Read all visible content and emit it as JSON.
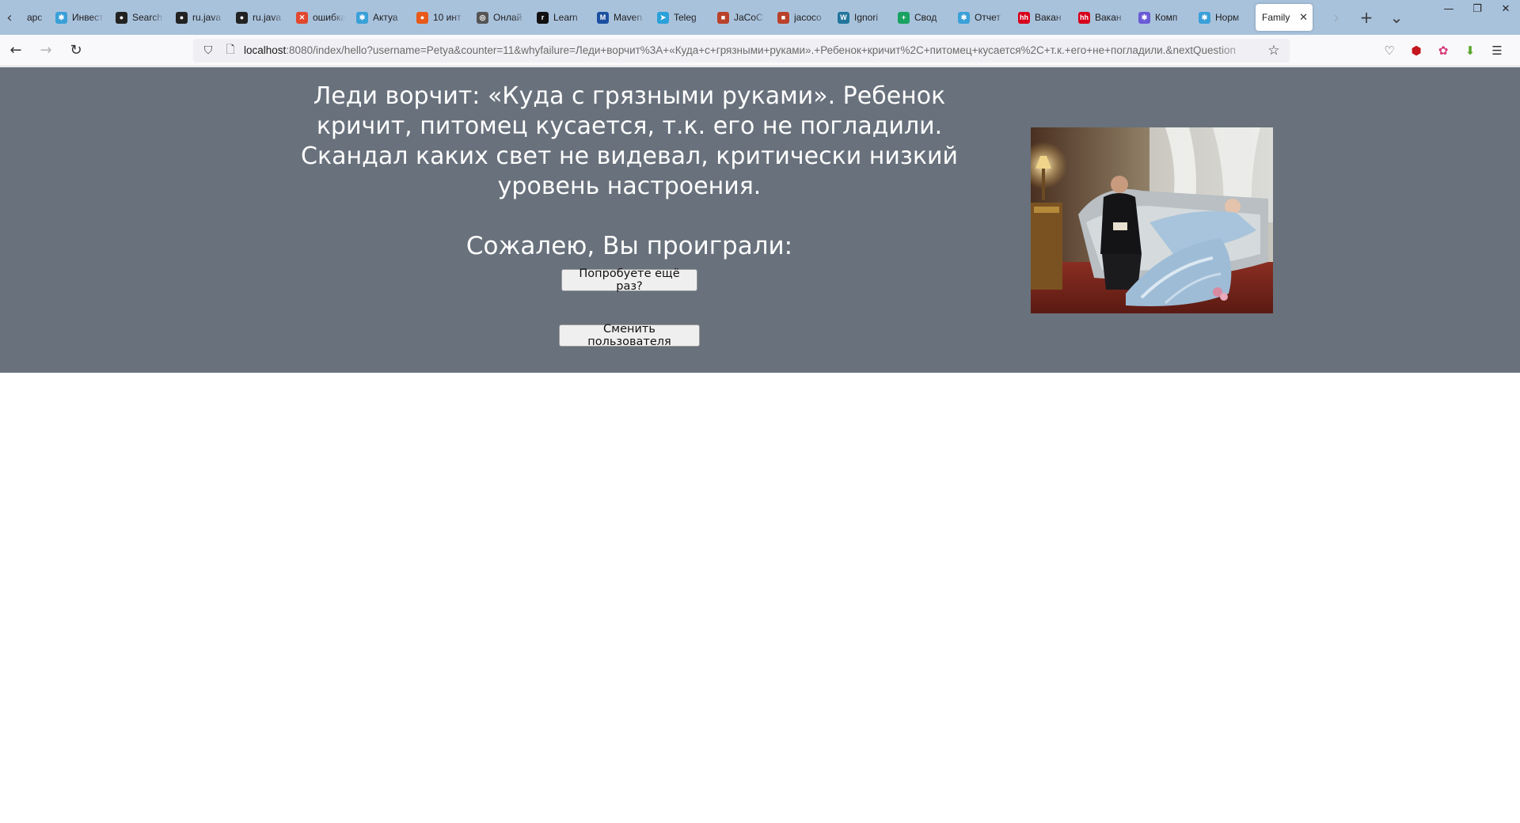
{
  "browser": {
    "tabs": [
      {
        "label": "арс",
        "color": "#7c93a8",
        "glyph": ""
      },
      {
        "label": "Инвест",
        "color": "#3aa0d8",
        "glyph": "✱"
      },
      {
        "label": "Search",
        "color": "#222222",
        "glyph": "●"
      },
      {
        "label": "ru.java",
        "color": "#222222",
        "glyph": "●"
      },
      {
        "label": "ru.java",
        "color": "#222222",
        "glyph": "●"
      },
      {
        "label": "ошибка",
        "color": "#e2482e",
        "glyph": "✕"
      },
      {
        "label": "Актуа",
        "color": "#3aa0d8",
        "glyph": "✱"
      },
      {
        "label": "10 инт",
        "color": "#e85a1a",
        "glyph": "●"
      },
      {
        "label": "Онлай",
        "color": "#555555",
        "glyph": "◎"
      },
      {
        "label": "Learn",
        "color": "#111111",
        "glyph": "r"
      },
      {
        "label": "Maven",
        "color": "#1c4fa0",
        "glyph": "M"
      },
      {
        "label": "Teleg",
        "color": "#2aa1da",
        "glyph": "➤"
      },
      {
        "label": "JaCoC",
        "color": "#b9412a",
        "glyph": "■"
      },
      {
        "label": "jacoco",
        "color": "#b9412a",
        "glyph": "■"
      },
      {
        "label": "Ignori",
        "color": "#21759b",
        "glyph": "W"
      },
      {
        "label": "Свод",
        "color": "#1aa260",
        "glyph": "+"
      },
      {
        "label": "Отчет",
        "color": "#3aa0d8",
        "glyph": "✱"
      },
      {
        "label": "Вакан",
        "color": "#d6001c",
        "glyph": "hh"
      },
      {
        "label": "Вакан",
        "color": "#d6001c",
        "glyph": "hh"
      },
      {
        "label": "Комп",
        "color": "#6b5bd6",
        "glyph": "✱"
      },
      {
        "label": "Норм",
        "color": "#3aa0d8",
        "glyph": "✱"
      }
    ],
    "active_tab": {
      "label": "Family",
      "close": "✕"
    },
    "url_host": "localhost",
    "url_rest": ":8080/index/hello?username=Petya&counter=11&whyfailure=Леди+ворчит%3A+«Куда+с+грязными+руками».+Ребенок+кричит%2C+питомец+кусается%2C+т.к.+его+не+погладили.&nextQuestion",
    "icons": {
      "back": "←",
      "forward": "→",
      "reload": "↻",
      "shield": "⛉",
      "page": "🗋",
      "star": "☆",
      "pocket": "♡",
      "ublock": "⬢",
      "ext1": "✿",
      "download": "⬇",
      "menu": "☰",
      "new_tab": "+",
      "list_tabs": "⌄",
      "scroll_left": "‹",
      "scroll_right": "›",
      "minimize": "—",
      "restore": "❐",
      "close": "✕"
    }
  },
  "game": {
    "message_line1": "Леди ворчит: «Куда с грязными руками». Ребенок кричит, питомец кусается, т.к. его не погладили.",
    "message_line2": "Скандал каких свет не видевал, критически низкий уровень настроения.",
    "result": "Сожалею, Вы проиграли:",
    "retry_button": "Попробуете ещё раз?",
    "switch_user_button": "Сменить пользователя",
    "colors": {
      "banner_bg": "#68717c",
      "text": "#ffffff"
    }
  }
}
